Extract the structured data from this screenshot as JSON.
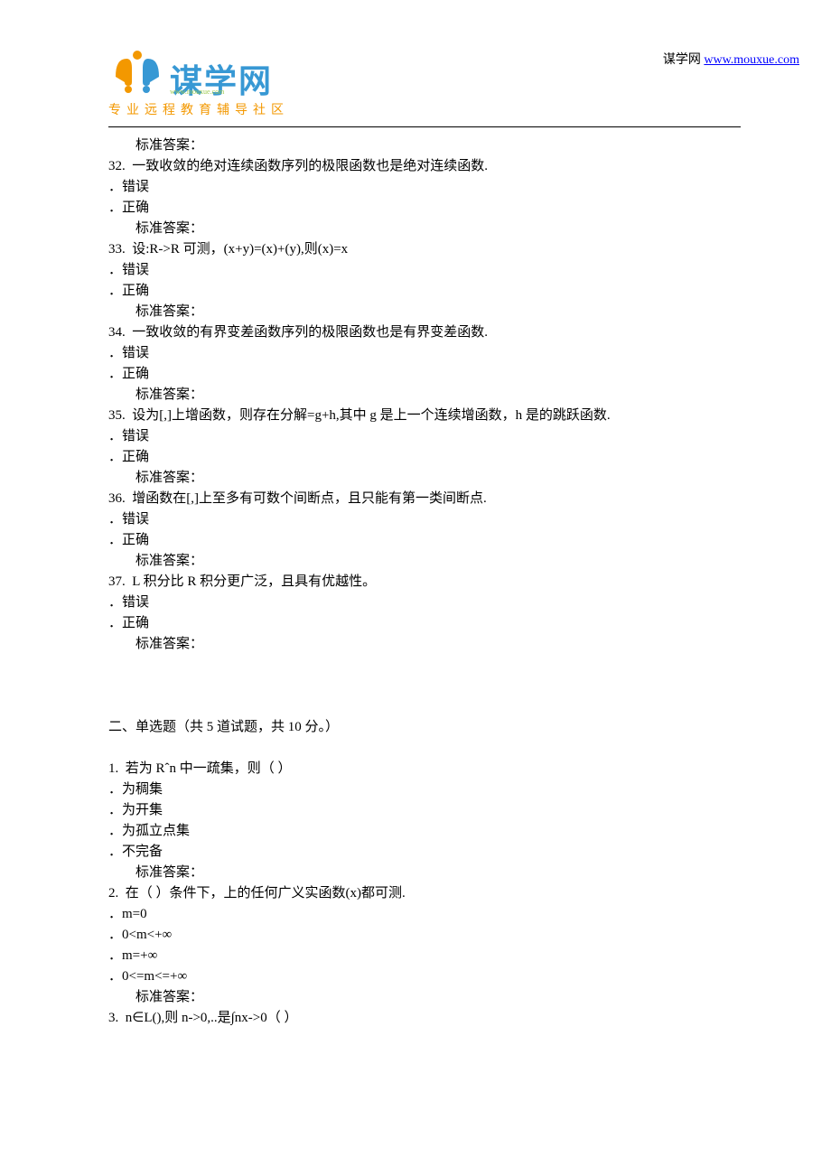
{
  "header": {
    "logo_main": "谋学网",
    "logo_url": "www.mouxue.com",
    "logo_tagline": "专业远程教育辅导社区",
    "right_label": "谋学网 ",
    "right_link": "www.mouxue.com"
  },
  "labels": {
    "standard_answer": "标准答案：",
    "wrong": "．错误",
    "correct": "．正确"
  },
  "questions": [
    {
      "num": "32.",
      "text": "一致收敛的绝对连续函数序列的极限函数也是绝对连续函数.",
      "type": "tf"
    },
    {
      "num": "33.",
      "text": "设:R->R 可测，(x+y)=(x)+(y),则(x)=x",
      "type": "tf"
    },
    {
      "num": "34.",
      "text": "一致收敛的有界变差函数序列的极限函数也是有界变差函数.",
      "type": "tf"
    },
    {
      "num": "35.",
      "text": "设为[,]上增函数，则存在分解=g+h,其中 g 是上一个连续增函数，h 是的跳跃函数.",
      "type": "tf"
    },
    {
      "num": "36.",
      "text": "增函数在[,]上至多有可数个间断点，且只能有第一类间断点.",
      "type": "tf"
    },
    {
      "num": "37.",
      "text": "L 积分比 R 积分更广泛，且具有优越性。",
      "type": "tf"
    }
  ],
  "section2": {
    "title": "二、单选题（共 5 道试题，共 10 分。）",
    "questions": [
      {
        "num": "1.",
        "text": "若为 Rˆn 中一疏集，则（ ）",
        "options": [
          "．为稠集",
          "．为开集",
          "．为孤立点集",
          "．不完备"
        ]
      },
      {
        "num": "2.",
        "text": "在（ ）条件下，上的任何广义实函数(x)都可测.",
        "options": [
          "．m=0",
          "．0<m<+∞",
          "．m=+∞",
          "．0<=m<=+∞"
        ]
      },
      {
        "num": "3.",
        "text": "n∈L(),则 n->0,..是∫nx->0（ ）",
        "options": []
      }
    ]
  }
}
